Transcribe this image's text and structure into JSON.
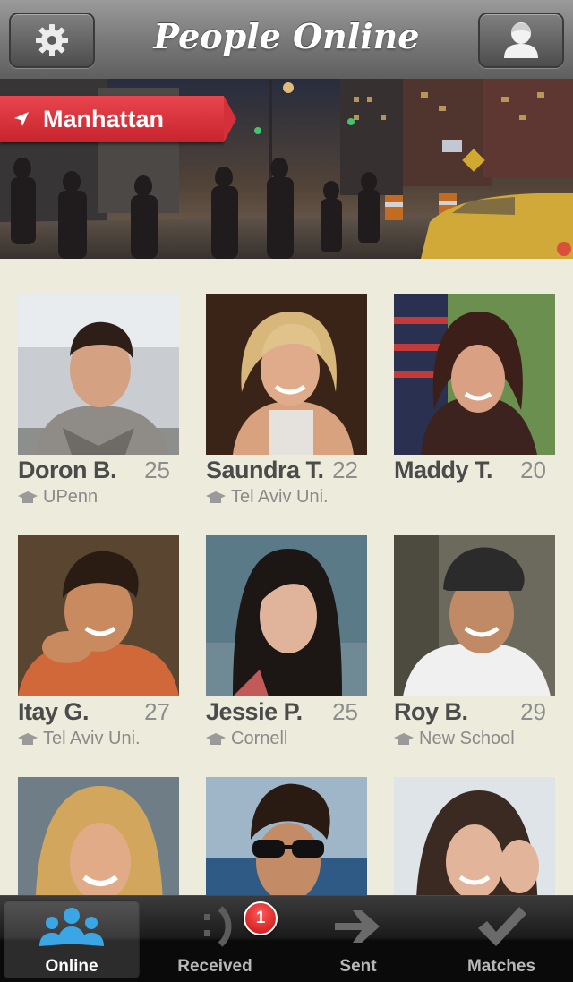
{
  "header": {
    "title": "People Online",
    "left_icon": "gear-icon",
    "right_icon": "profile-icon"
  },
  "hero": {
    "location": "Manhattan",
    "location_icon": "location-arrow-icon"
  },
  "people": [
    {
      "name": "Doron B.",
      "age": "25",
      "school": "UPenn"
    },
    {
      "name": "Saundra T.",
      "age": "22",
      "school": "Tel Aviv Uni."
    },
    {
      "name": "Maddy T.",
      "age": "20",
      "school": ""
    },
    {
      "name": "Itay G.",
      "age": "27",
      "school": "Tel Aviv Uni."
    },
    {
      "name": "Jessie P.",
      "age": "25",
      "school": "Cornell"
    },
    {
      "name": "Roy B.",
      "age": "29",
      "school": "New School"
    },
    {
      "name": "",
      "age": "",
      "school": ""
    },
    {
      "name": "",
      "age": "",
      "school": ""
    },
    {
      "name": "",
      "age": "",
      "school": ""
    }
  ],
  "tabs": [
    {
      "label": "Online",
      "icon": "people-icon",
      "active": true
    },
    {
      "label": "Received",
      "icon": "wink-icon",
      "badge": "1"
    },
    {
      "label": "Sent",
      "icon": "arrow-right-icon"
    },
    {
      "label": "Matches",
      "icon": "checkmark-icon"
    }
  ],
  "colors": {
    "background": "#ecebdc",
    "banner_red": "#d43039",
    "badge_red": "#c80f0f",
    "tab_active_blue": "#3aa6e6"
  }
}
